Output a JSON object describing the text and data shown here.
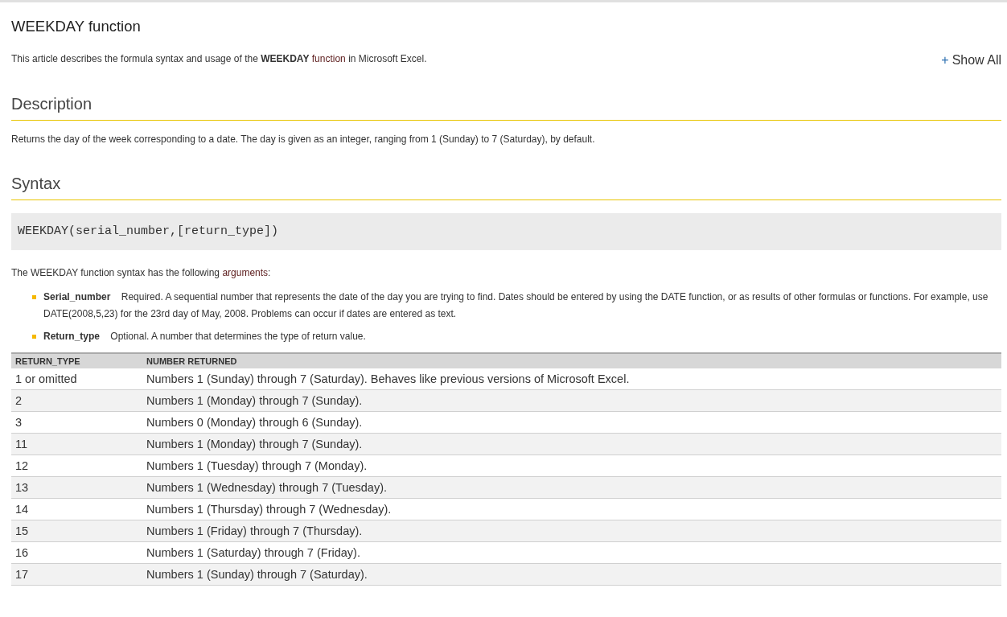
{
  "title": "WEEKDAY function",
  "intro": {
    "before": "This article describes the formula syntax and usage of the **WEEKDAY**",
    "link": "function",
    "after": "in Microsoft Excel."
  },
  "show_all": {
    "icon": "+",
    "label": "Show All"
  },
  "sections": [
    {
      "heading": "Description",
      "paragraph": "Returns the day of the week corresponding to a date. The day is given as an integer, ranging from 1 (Sunday) to 7 (Saturday), by default."
    },
    {
      "heading": "Syntax",
      "code": "WEEKDAY(serial_number,[return_type])",
      "arguments_intro": {
        "before": "The WEEKDAY function syntax has the following",
        "link": "arguments",
        "after": ":"
      },
      "arguments": [
        {
          "text": "**Serial_number**    Required. A sequential number that represents the date of the day you are trying to find. Dates should be entered by using the DATE function, or as results of other formulas or functions. For example, use DATE(2008,5,23) for the 23rd day of May, 2008. Problems can occur if dates are entered as text."
        },
        {
          "text": "**Return_type**    Optional. A number that determines the type of return value."
        }
      ]
    }
  ],
  "table": {
    "columns": [
      "RETURN_TYPE",
      "NUMBER RETURNED"
    ],
    "rows": [
      [
        "1 or omitted",
        "Numbers 1 (Sunday) through 7 (Saturday). Behaves like previous versions of Microsoft Excel."
      ],
      [
        "2",
        "Numbers 1 (Monday) through 7 (Sunday)."
      ],
      [
        "3",
        "Numbers 0 (Monday) through 6 (Sunday)."
      ],
      [
        "11",
        "Numbers 1 (Monday) through 7 (Sunday)."
      ],
      [
        "12",
        "Numbers 1 (Tuesday) through 7 (Monday)."
      ],
      [
        "13",
        "Numbers 1 (Wednesday) through 7 (Tuesday)."
      ],
      [
        "14",
        "Numbers 1 (Thursday) through 7 (Wednesday)."
      ],
      [
        "15",
        "Numbers 1 (Friday) through 7 (Thursday)."
      ],
      [
        "16",
        "Numbers 1 (Saturday) through 7 (Friday)."
      ],
      [
        "17",
        "Numbers 1 (Sunday) through 7 (Saturday)."
      ]
    ]
  }
}
